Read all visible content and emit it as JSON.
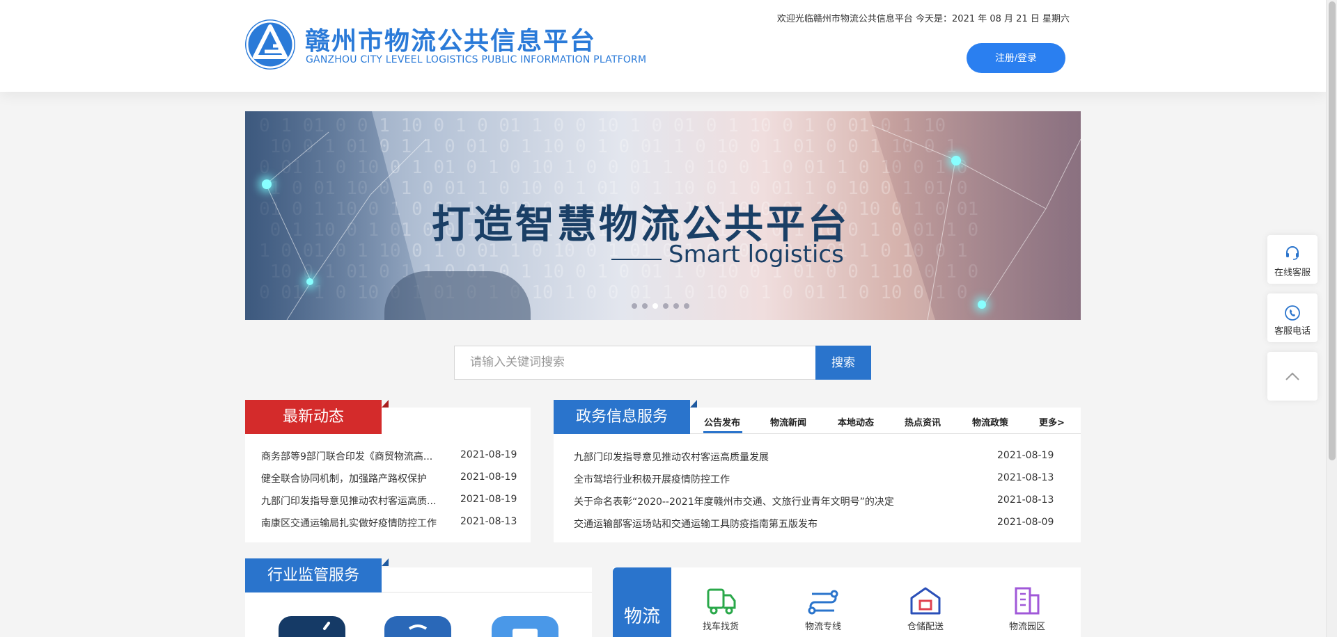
{
  "header": {
    "brand_title": "赣州市物流公共信息平台",
    "brand_subtitle": "GANZHOU CITY LEVEEL LOGISTICS PUBLIC INFORMATION PLATFORM",
    "welcome_text": "欢迎光临赣州市物流公共信息平台 今天是：2021 年 08 月 21 日 星期六",
    "login_label": "注册/登录"
  },
  "banner": {
    "title": "打造智慧物流公共平台",
    "subtitle": "Smart logistics",
    "slide_count": 6,
    "active_slide": 3
  },
  "search": {
    "placeholder": "请输入关键词搜索",
    "button_label": "搜索"
  },
  "latest_news": {
    "tab_label": "最新动态",
    "items": [
      {
        "title": "商务部等9部门联合印发《商贸物流高...",
        "date": "2021-08-19"
      },
      {
        "title": "健全联合协同机制，加强路产路权保护",
        "date": "2021-08-19"
      },
      {
        "title": "九部门印发指导意见推动农村客运高质...",
        "date": "2021-08-19"
      },
      {
        "title": "南康区交通运输局扎实做好疫情防控工作",
        "date": "2021-08-13"
      }
    ]
  },
  "gov_service": {
    "tab_label": "政务信息服务",
    "tabs": [
      "公告发布",
      "物流新闻",
      "本地动态",
      "热点资讯",
      "物流政策",
      "更多>"
    ],
    "active_tab": 0,
    "items": [
      {
        "title": "九部门印发指导意见推动农村客运高质量发展",
        "date": "2021-08-19"
      },
      {
        "title": "全市驾培行业积极开展疫情防控工作",
        "date": "2021-08-13"
      },
      {
        "title": "关于命名表彰“2020--2021年度赣州市交通、文旅行业青年文明号”的决定",
        "date": "2021-08-13"
      },
      {
        "title": "交通运输部客运场站和交通运输工具防疫指南第五版发布",
        "date": "2021-08-09"
      }
    ]
  },
  "industry": {
    "tab_label": "行业监管服务"
  },
  "logistics": {
    "side_label": "物流",
    "items": [
      {
        "label": "找车找货",
        "icon": "truck-icon",
        "color": "#2aa84a"
      },
      {
        "label": "物流专线",
        "icon": "route-icon",
        "color": "#2a74cc"
      },
      {
        "label": "仓储配送",
        "icon": "warehouse-icon",
        "color": "#2a4fb8"
      },
      {
        "label": "物流园区",
        "icon": "building-icon",
        "color": "#a058d8"
      }
    ]
  },
  "side_tools": {
    "online_service": "在线客服",
    "service_phone": "客服电话"
  },
  "colors": {
    "brand_blue": "#2a7ad8",
    "red_tab": "#d42b2b",
    "blue_tab": "#2a74cc"
  }
}
